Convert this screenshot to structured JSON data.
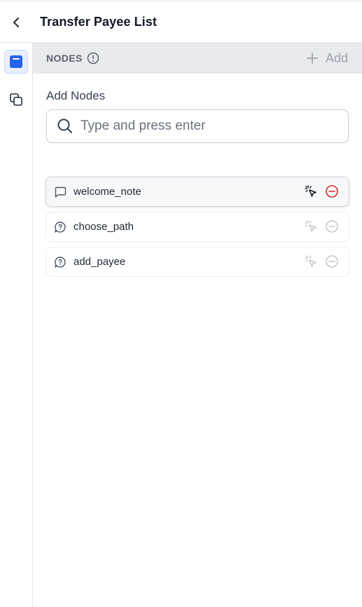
{
  "header": {
    "title": "Transfer Payee List"
  },
  "section": {
    "title": "NODES",
    "add_label": "Add"
  },
  "search": {
    "label": "Add Nodes",
    "placeholder": "Type and press enter"
  },
  "nodes": [
    {
      "name": "welcome_note",
      "type_icon": "message-icon",
      "selected": true
    },
    {
      "name": "choose_path",
      "type_icon": "question-message-icon",
      "selected": false
    },
    {
      "name": "add_payee",
      "type_icon": "question-message-icon",
      "selected": false
    }
  ],
  "colors": {
    "accent": "#2563eb",
    "danger": "#dc2626",
    "muted": "#c4c8ce"
  }
}
